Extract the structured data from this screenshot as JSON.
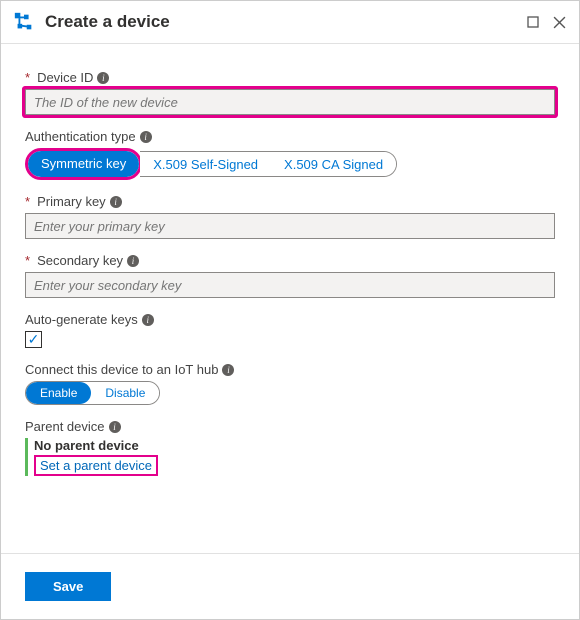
{
  "header": {
    "title": "Create a device"
  },
  "labels": {
    "device_id": "Device ID",
    "auth_type": "Authentication type",
    "primary_key": "Primary key",
    "secondary_key": "Secondary key",
    "autogen": "Auto-generate keys",
    "connect_hub": "Connect this device to an IoT hub",
    "parent_device": "Parent device"
  },
  "inputs": {
    "device_id_placeholder": "The ID of the new device",
    "primary_key_placeholder": "Enter your primary key",
    "secondary_key_placeholder": "Enter your secondary key"
  },
  "auth_options": {
    "symmetric": "Symmetric key",
    "self_signed": "X.509 Self-Signed",
    "ca_signed": "X.509 CA Signed"
  },
  "iot_toggle": {
    "enable": "Enable",
    "disable": "Disable"
  },
  "parent": {
    "none": "No parent device",
    "set_link": "Set a parent device"
  },
  "footer": {
    "save": "Save"
  },
  "checkbox": {
    "autogen_checked": "✓"
  }
}
